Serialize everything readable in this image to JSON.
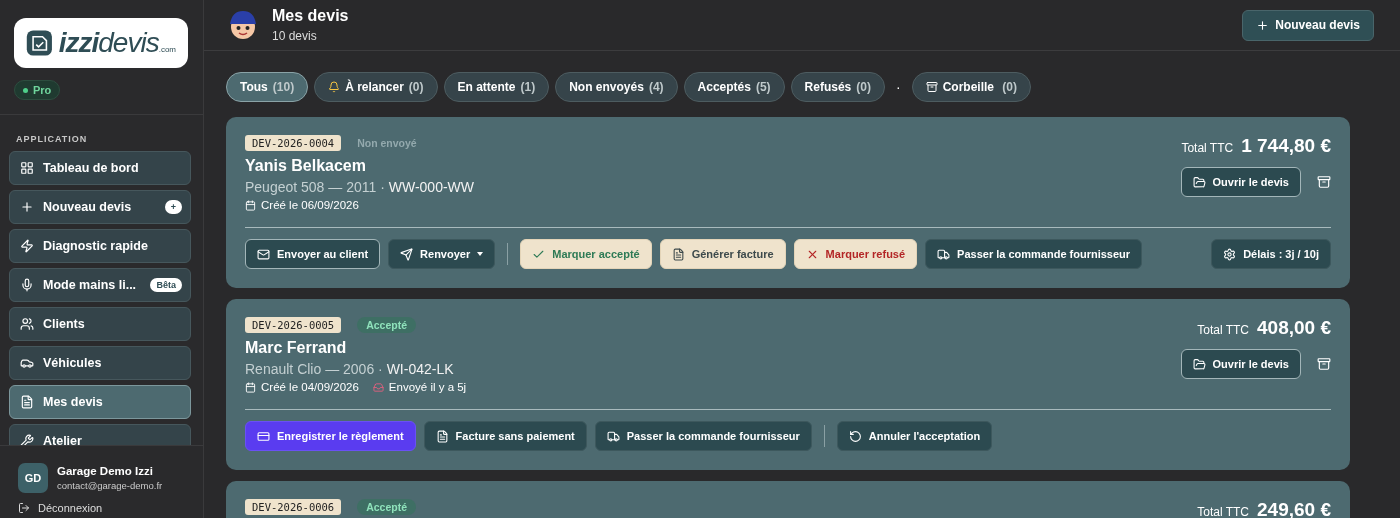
{
  "sidebar": {
    "logo": {
      "bold": "izzi",
      "light": "devis",
      "domain": ".com"
    },
    "plan": "Pro",
    "section": "APPLICATION",
    "items": [
      {
        "label": "Tableau de bord",
        "kind": "dashboard",
        "selected": false
      },
      {
        "label": "Nouveau devis",
        "kind": "create",
        "selected": false,
        "badge": "+"
      },
      {
        "label": "Diagnostic rapide",
        "kind": "diagnostic",
        "selected": false
      },
      {
        "label": "Mode mains li...",
        "kind": "voice",
        "selected": false,
        "badge": "Bêta"
      },
      {
        "label": "Clients",
        "kind": "clients",
        "selected": false
      },
      {
        "label": "Véhicules",
        "kind": "vehicles",
        "selected": false
      },
      {
        "label": "Mes devis",
        "kind": "quotes",
        "selected": true
      },
      {
        "label": "Atelier",
        "kind": "workshop",
        "selected": false
      }
    ],
    "user": {
      "initials": "GD",
      "name": "Garage Demo Izzi",
      "email": "contact@garage-demo.fr"
    },
    "logout": "Déconnexion"
  },
  "header": {
    "title": "Mes devis",
    "subtitle": "10 devis",
    "new_button": "Nouveau devis"
  },
  "filters": [
    {
      "label": "Tous",
      "count": "(10)",
      "selected": true
    },
    {
      "label": "À relancer",
      "count": "(0)",
      "selected": false,
      "kind": "reminder"
    },
    {
      "label": "En attente",
      "count": "(1)",
      "selected": false
    },
    {
      "label": "Non envoyés",
      "count": "(4)",
      "selected": false
    },
    {
      "label": "Acceptés",
      "count": "(5)",
      "selected": false
    },
    {
      "label": "Refusés",
      "count": "(0)",
      "selected": false
    }
  ],
  "filter_separator": "·",
  "trash_filter": {
    "label": "Corbeille",
    "count": "(0)",
    "selected": false
  },
  "quotes": [
    {
      "ref": "DEV-2026-0004",
      "status": {
        "label": "Non envoyé",
        "kind": "draft"
      },
      "client": "Yanis Belkacem",
      "vehicle": "Peugeot 508 — 2011 ·",
      "plate": "WW-000-WW",
      "created": "Créé le 06/09/2026",
      "total_label": "Total TTC",
      "total": "1 744,80 €",
      "open_button": "Ouvrir le devis",
      "action_groups": [
        [
          {
            "label": "Envoyer au client",
            "kind": "send_email"
          },
          {
            "label": "Renvoyer",
            "kind": "resend",
            "caret": true
          }
        ],
        [
          {
            "label": "Marquer accepté",
            "kind": "accept"
          },
          {
            "label": "Générer facture",
            "kind": "invoice"
          },
          {
            "label": "Marquer refusé",
            "kind": "refuse"
          },
          {
            "label": "Passer la commande fournisseur",
            "kind": "supplier"
          }
        ]
      ],
      "side_action": {
        "label": "Délais : 3j / 10j",
        "kind": "delays"
      }
    },
    {
      "ref": "DEV-2026-0005",
      "status": {
        "label": "Accepté",
        "kind": "accepted"
      },
      "client": "Marc Ferrand",
      "vehicle": "Renault Clio — 2006 ·",
      "plate": "WI-042-LK",
      "created": "Créé le 04/09/2026",
      "sent": "Envoyé il y a 5j",
      "total_label": "Total TTC",
      "total": "408,00 €",
      "open_button": "Ouvrir le devis",
      "action_groups": [
        [
          {
            "label": "Enregistrer le règlement",
            "kind": "payment"
          },
          {
            "label": "Facture sans paiement",
            "kind": "unpaid_invoice"
          },
          {
            "label": "Passer la commande fournisseur",
            "kind": "supplier"
          }
        ],
        [
          {
            "label": "Annuler l'acceptation",
            "kind": "cancel_accept"
          }
        ]
      ]
    },
    {
      "ref": "DEV-2026-0006",
      "status": {
        "label": "Accepté",
        "kind": "accepted"
      },
      "total_label": "Total TTC",
      "total": "249,60 €"
    }
  ]
}
